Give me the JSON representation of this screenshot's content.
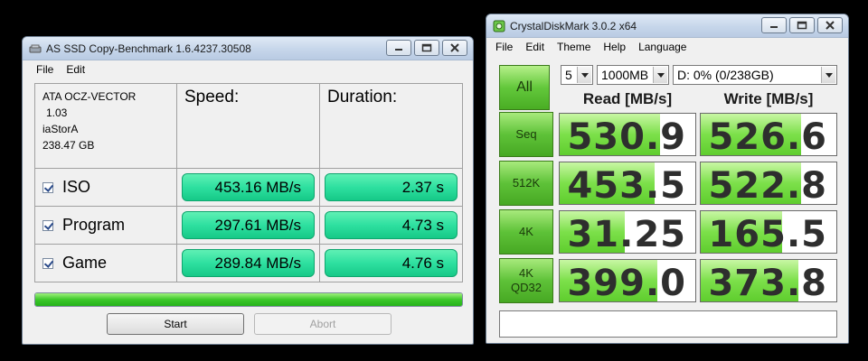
{
  "asssd": {
    "title": "AS SSD Copy-Benchmark 1.6.4237.30508",
    "menu": [
      "File",
      "Edit"
    ],
    "drive": {
      "model": "ATA OCZ-VECTOR",
      "firmware": "1.03",
      "driver": "iaStorA",
      "size": "238.47 GB"
    },
    "headers": {
      "speed": "Speed:",
      "duration": "Duration:"
    },
    "rows": [
      {
        "label": "ISO",
        "speed": "453.16 MB/s",
        "duration": "2.37 s"
      },
      {
        "label": "Program",
        "speed": "297.61 MB/s",
        "duration": "4.73 s"
      },
      {
        "label": "Game",
        "speed": "289.84 MB/s",
        "duration": "4.76 s"
      }
    ],
    "progress_percent": 100,
    "buttons": {
      "start": "Start",
      "abort": "Abort"
    }
  },
  "cdm": {
    "title": "CrystalDiskMark 3.0.2 x64",
    "menu": [
      "File",
      "Edit",
      "Theme",
      "Help",
      "Language"
    ],
    "all_label": "All",
    "count": "5",
    "size": "1000MB",
    "drive": "D: 0% (0/238GB)",
    "read_header": "Read [MB/s]",
    "write_header": "Write [MB/s]",
    "tests": [
      {
        "label": [
          "Seq"
        ],
        "read": "530.9",
        "write": "526.6"
      },
      {
        "label": [
          "512K"
        ],
        "read": "453.5",
        "write": "522.8"
      },
      {
        "label": [
          "4K"
        ],
        "read": "31.25",
        "write": "165.5"
      },
      {
        "label": [
          "4K",
          "QD32"
        ],
        "read": "399.0",
        "write": "373.8"
      }
    ]
  }
}
